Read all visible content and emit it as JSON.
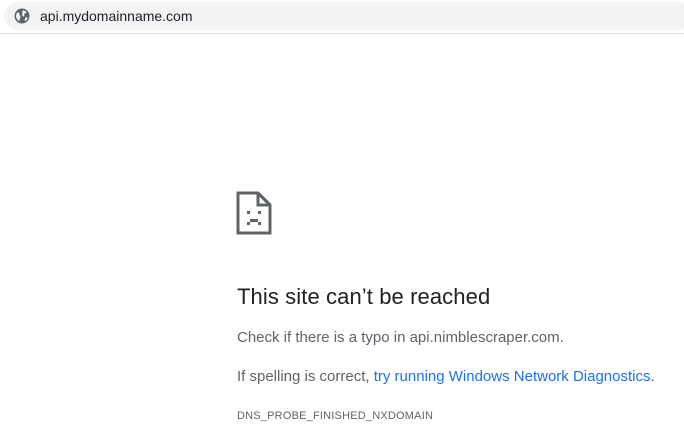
{
  "address_bar": {
    "url": "api.mydomainname.com",
    "site_icon": "globe-icon"
  },
  "error_page": {
    "icon": "sad-page-icon",
    "title": "This site can’t be reached",
    "suggestion_1": "Check if there is a typo in api.nimblescraper.com.",
    "suggestion_2_prefix": "If spelling is correct, ",
    "suggestion_2_link": "try running Windows Network Diagnostics",
    "suggestion_2_suffix": ".",
    "error_code": "DNS_PROBE_FINISHED_NXDOMAIN"
  },
  "colors": {
    "link": "#1a73e8",
    "text_primary": "#202124",
    "text_secondary": "#5f6368",
    "omnibox_bg": "#f1f3f4"
  }
}
